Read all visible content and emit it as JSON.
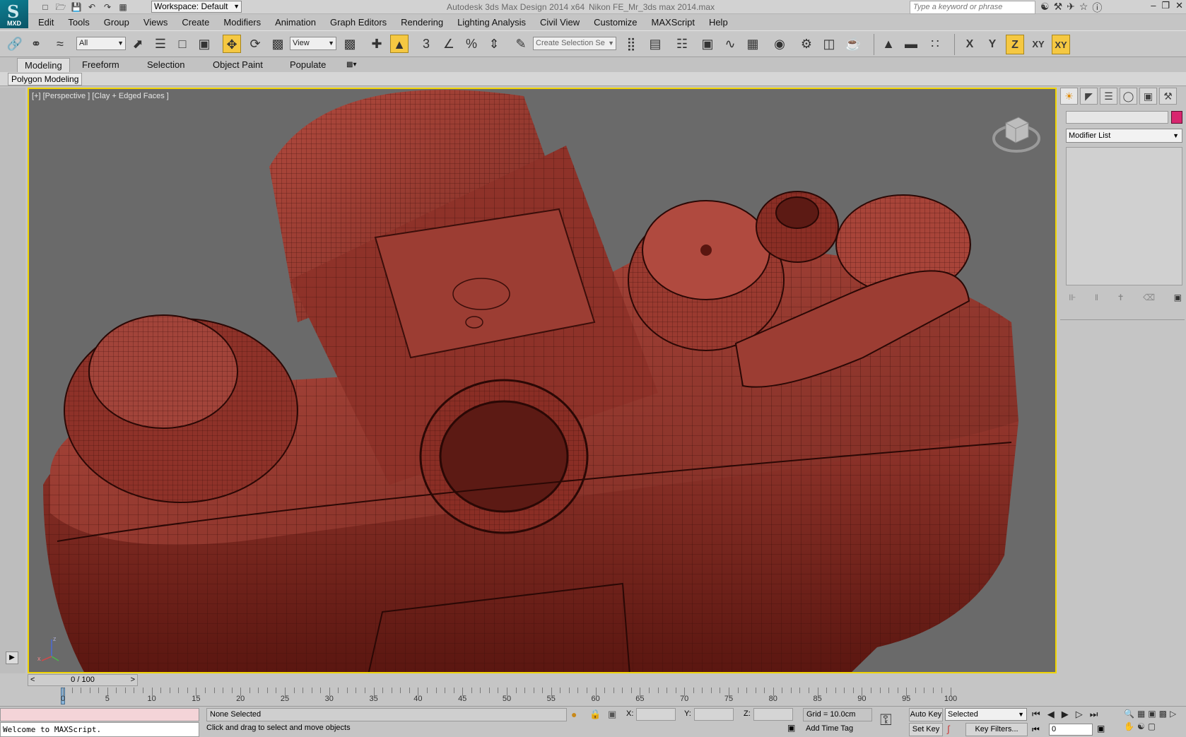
{
  "app": {
    "logo_text": "MXD",
    "title": "Autodesk 3ds Max Design 2014 x64",
    "file": "Nikon FE_Mr_3ds max 2014.max",
    "workspace": "Workspace: Default",
    "search_placeholder": "Type a keyword or phrase"
  },
  "menu": [
    "Edit",
    "Tools",
    "Group",
    "Views",
    "Create",
    "Modifiers",
    "Animation",
    "Graph Editors",
    "Rendering",
    "Lighting Analysis",
    "Civil View",
    "Customize",
    "MAXScript",
    "Help"
  ],
  "toolbar": {
    "filter": "All",
    "refcoord": "View",
    "selection_set_placeholder": "Create Selection Se",
    "snap_label": "3",
    "axes": [
      "X",
      "Y",
      "Z",
      "XY",
      "XY"
    ],
    "active_axis": "Z"
  },
  "ribbon": {
    "tabs": [
      "Modeling",
      "Freeform",
      "Selection",
      "Object Paint",
      "Populate"
    ],
    "active_tab": "Modeling",
    "panel": "Polygon Modeling"
  },
  "viewport": {
    "label": "[+] [Perspective ] [Clay + Edged Faces ]",
    "axis_z": "z",
    "axis_x": "x",
    "active_border_color": "#f0d400",
    "model_color": "#7a2a22"
  },
  "command_panel": {
    "modifier_list": "Modifier List",
    "object_color": "#d8266f",
    "tab_icons": [
      "create-icon",
      "modify-icon",
      "hierarchy-icon",
      "motion-icon",
      "display-icon",
      "utilities-icon"
    ]
  },
  "timeline": {
    "slider": "0 / 100",
    "prev": "<",
    "next": ">",
    "ticks": [
      "0",
      "5",
      "10",
      "15",
      "20",
      "25",
      "30",
      "35",
      "40",
      "45",
      "50",
      "55",
      "60",
      "65",
      "70",
      "75",
      "80",
      "85",
      "90",
      "95",
      "100"
    ]
  },
  "status": {
    "listener_text": "Welcome to MAXScript.",
    "selection": "None Selected",
    "prompt": "Click and drag to select and move objects",
    "x_label": "X:",
    "y_label": "Y:",
    "z_label": "Z:",
    "grid": "Grid = 10.0cm",
    "add_time_tag": "Add Time Tag",
    "auto_key": "Auto Key",
    "set_key": "Set Key",
    "selected": "Selected",
    "key_filters": "Key Filters...",
    "frame": "0"
  }
}
